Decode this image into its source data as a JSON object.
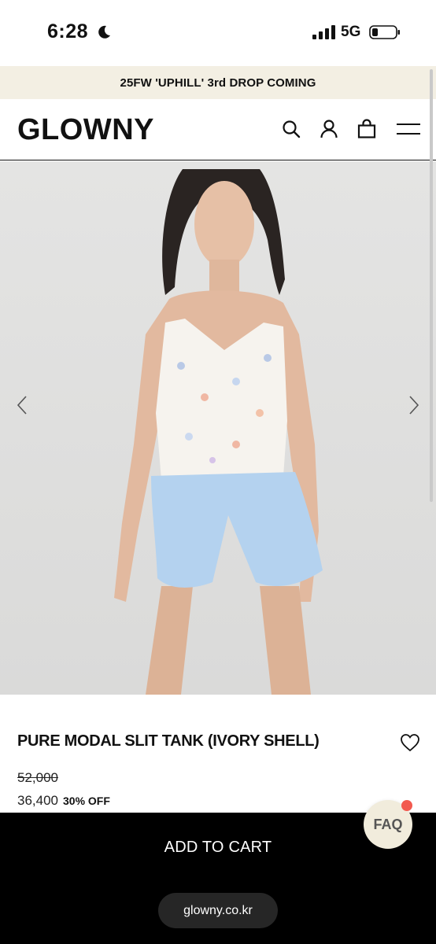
{
  "status_bar": {
    "time": "6:28",
    "network": "5G"
  },
  "announcement": {
    "text": "25FW 'UPHILL' 3rd DROP COMING"
  },
  "header": {
    "logo": "GLOWNY",
    "icons": [
      "search-icon",
      "account-icon",
      "bag-icon",
      "menu-icon"
    ]
  },
  "gallery": {
    "prev_icon": "chevron-left-icon",
    "next_icon": "chevron-right-icon"
  },
  "product": {
    "title": "PURE MODAL SLIT TANK (IVORY SHELL)",
    "original_price": "52,000",
    "sale_price": "36,400",
    "discount": "30% OFF"
  },
  "cart": {
    "button_label": "ADD TO CART",
    "site_url": "glowny.co.kr"
  },
  "faq": {
    "label": "FAQ",
    "badge_color": "#f25a4f"
  },
  "colors": {
    "announcement_bg": "#f3efe3",
    "cart_bar_bg": "#000000",
    "faq_bg": "#f1ecdc"
  }
}
